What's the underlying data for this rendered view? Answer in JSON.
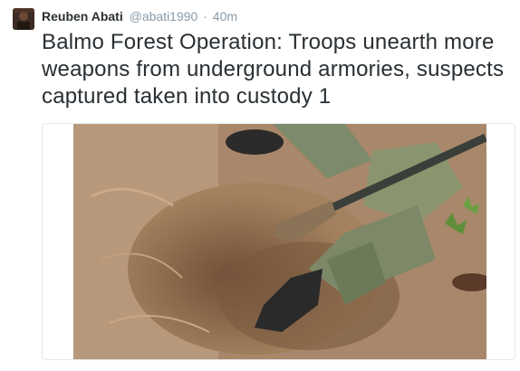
{
  "tweet": {
    "author_name": "Reuben Abati",
    "author_handle": "@abati1990",
    "separator": "·",
    "time": "40m",
    "text": "Balmo Forest Operation: Troops unearth more weapons from underground armories, suspects captured taken into custody 1"
  },
  "media": {
    "icon": "photo-icon",
    "description_colors": {
      "soil": "#a9876a",
      "camouflage": "#7d8a6a",
      "boot": "#2b2b2b"
    }
  },
  "colors": {
    "text": "#292f33",
    "muted": "#8899a6",
    "border": "#e1e8ed"
  }
}
